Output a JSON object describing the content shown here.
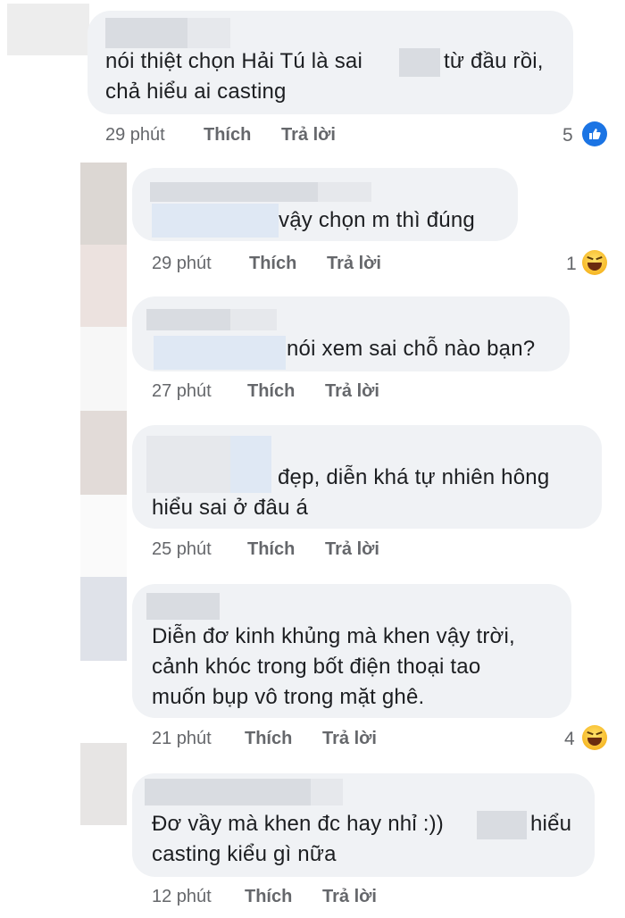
{
  "comments": [
    {
      "text_lines": [
        "nói thiệt chọn Hải Tú là sai",
        "chả hiểu ai casting"
      ],
      "text_after_redaction": "từ đầu rồi,",
      "time": "29 phút",
      "like_label": "Thích",
      "reply_label": "Trả lời",
      "reaction_count": "5",
      "reaction_icon": "like-icon"
    },
    {
      "text_lines": [
        "vậy chọn m thì đúng"
      ],
      "time": "29 phút",
      "like_label": "Thích",
      "reply_label": "Trả lời",
      "reaction_count": "1",
      "reaction_icon": "haha-icon"
    },
    {
      "text_lines": [
        "nói xem sai chỗ nào bạn?"
      ],
      "time": "27 phút",
      "like_label": "Thích",
      "reply_label": "Trả lời"
    },
    {
      "text_lines": [
        "đẹp, diễn khá tự nhiên hông",
        "hiểu sai ở đâu á"
      ],
      "time": "25 phút",
      "like_label": "Thích",
      "reply_label": "Trả lời"
    },
    {
      "text_lines": [
        "Diễn đơ kinh khủng mà khen vậy trời,",
        "cảnh khóc trong bốt điện thoại tao",
        "muốn bụp vô trong mặt ghê."
      ],
      "time": "21 phút",
      "like_label": "Thích",
      "reply_label": "Trả lời",
      "reaction_count": "4",
      "reaction_icon": "haha-icon"
    },
    {
      "text_lines": [
        "Đơ vầy mà khen đc hay nhỉ :))",
        "casting kiểu gì nữa"
      ],
      "text_after_redaction": "hiểu",
      "time": "12 phút",
      "like_label": "Thích",
      "reply_label": "Trả lời"
    }
  ]
}
